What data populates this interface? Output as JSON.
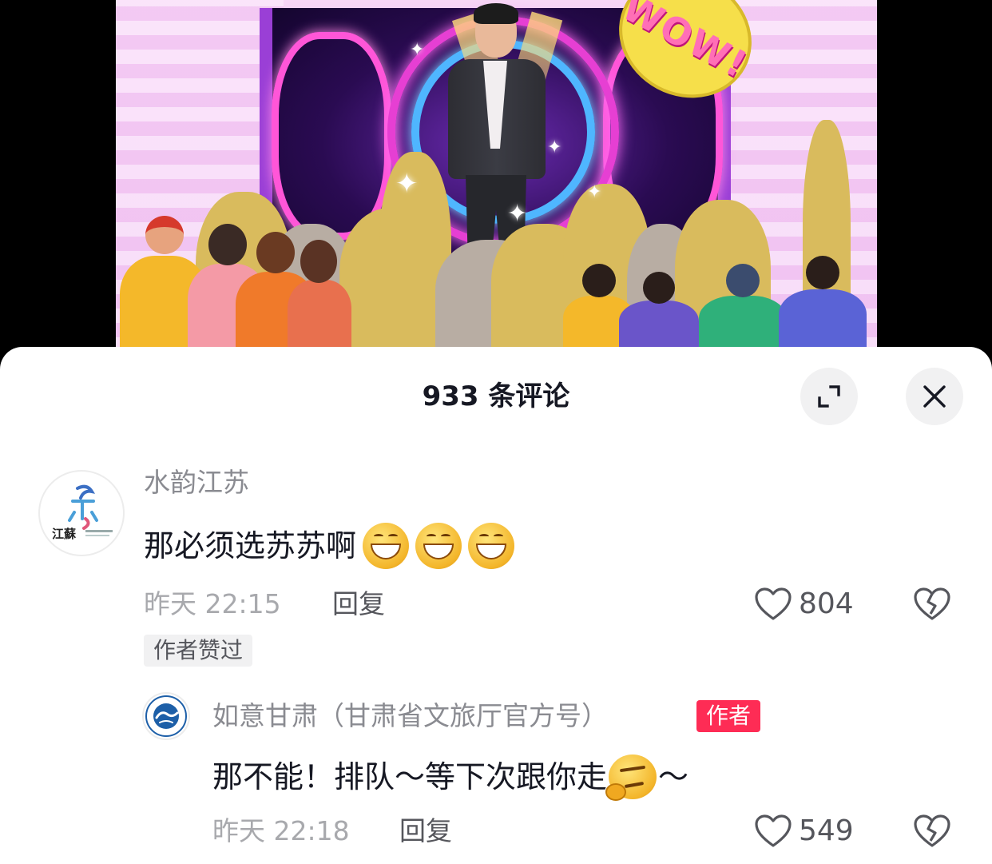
{
  "video": {
    "bubble_text": "WOW!"
  },
  "comments_panel": {
    "title": "933 条评论",
    "expand_icon": "expand-icon",
    "close_icon": "close-icon"
  },
  "comments": [
    {
      "username": "水韵江苏",
      "text": "那必须选苏苏啊",
      "emojis": [
        "grin-emoji",
        "grin-emoji",
        "grin-emoji"
      ],
      "time": "昨天 22:15",
      "reply_label": "回复",
      "likes": "804",
      "author_liked_tag": "作者赞过",
      "avatar_label": "江蘇"
    },
    {
      "username": "如意甘肃（甘肃省文旅厅官方号）",
      "author_badge": "作者",
      "text_part1": "那不能！排队～等下次跟你走",
      "text_part2": "～",
      "emoji": "thinking-emoji",
      "time": "昨天 22:18",
      "reply_label": "回复",
      "likes": "549"
    }
  ],
  "colors": {
    "author_badge": "#fe2c55",
    "text_primary": "#161823",
    "text_secondary": "#8a8b91"
  }
}
